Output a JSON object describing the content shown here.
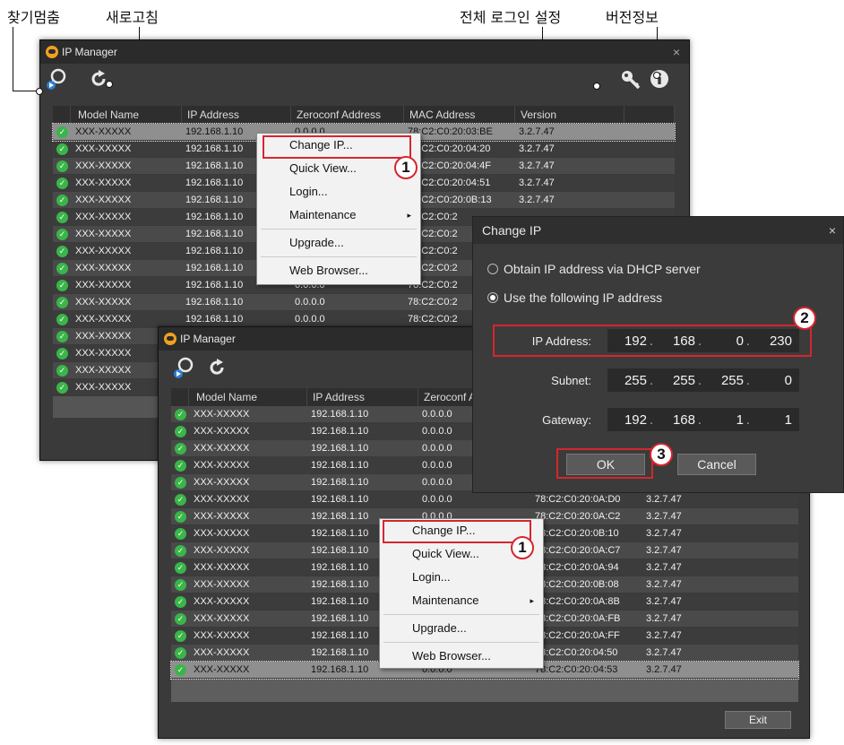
{
  "annotations": {
    "stop_search": "찾기멈춤",
    "refresh": "새로고침",
    "global_login": "전체 로그인 설정",
    "version_info": "버전정보",
    "badge_1": "1",
    "badge_2": "2",
    "badge_3": "3"
  },
  "window": {
    "title": "IP Manager",
    "close": "×",
    "exit_label": "Exit"
  },
  "table": {
    "headers": [
      "Model Name",
      "IP Address",
      "Zeroconf Address",
      "MAC Address",
      "Version"
    ]
  },
  "back_rows": [
    {
      "model": "XXX-XXXXX",
      "ip": "192.168.1.10",
      "zc": "0.0.0.0",
      "mac": "78:C2:C0:20:03:BE",
      "ver": "3.2.7.47"
    },
    {
      "model": "XXX-XXXXX",
      "ip": "192.168.1.10",
      "zc": "0.0.0.0",
      "mac": "78:C2:C0:20:04:20",
      "ver": "3.2.7.47"
    },
    {
      "model": "XXX-XXXXX",
      "ip": "192.168.1.10",
      "zc": "0.0.0.0",
      "mac": "78:C2:C0:20:04:4F",
      "ver": "3.2.7.47"
    },
    {
      "model": "XXX-XXXXX",
      "ip": "192.168.1.10",
      "zc": "0.0.0.0",
      "mac": "78:C2:C0:20:04:51",
      "ver": "3.2.7.47"
    },
    {
      "model": "XXX-XXXXX",
      "ip": "192.168.1.10",
      "zc": "0.0.0.0",
      "mac": "78:C2:C0:20:0B:13",
      "ver": "3.2.7.47"
    },
    {
      "model": "XXX-XXXXX",
      "ip": "192.168.1.10",
      "zc": "0.0.0.0",
      "mac": "78:C2:C0:2",
      "ver": ""
    },
    {
      "model": "XXX-XXXXX",
      "ip": "192.168.1.10",
      "zc": "0.0.0.0",
      "mac": "78:C2:C0:2",
      "ver": ""
    },
    {
      "model": "XXX-XXXXX",
      "ip": "192.168.1.10",
      "zc": "0.0.0.0",
      "mac": "78:C2:C0:2",
      "ver": ""
    },
    {
      "model": "XXX-XXXXX",
      "ip": "192.168.1.10",
      "zc": "0.0.0.0",
      "mac": "78:C2:C0:2",
      "ver": ""
    },
    {
      "model": "XXX-XXXXX",
      "ip": "192.168.1.10",
      "zc": "0.0.0.0",
      "mac": "78:C2:C0:2",
      "ver": ""
    },
    {
      "model": "XXX-XXXXX",
      "ip": "192.168.1.10",
      "zc": "0.0.0.0",
      "mac": "78:C2:C0:2",
      "ver": ""
    },
    {
      "model": "XXX-XXXXX",
      "ip": "192.168.1.10",
      "zc": "0.0.0.0",
      "mac": "78:C2:C0:2",
      "ver": ""
    },
    {
      "model": "XXX-XXXXX",
      "ip": "",
      "zc": "",
      "mac": "",
      "ver": ""
    },
    {
      "model": "XXX-XXXXX",
      "ip": "",
      "zc": "",
      "mac": "",
      "ver": ""
    },
    {
      "model": "XXX-XXXXX",
      "ip": "",
      "zc": "",
      "mac": "",
      "ver": ""
    },
    {
      "model": "XXX-XXXXX",
      "ip": "",
      "zc": "",
      "mac": "",
      "ver": ""
    }
  ],
  "front_rows": [
    {
      "model": "XXX-XXXXX",
      "ip": "192.168.1.10",
      "zc": "0.0.0.0",
      "mac": "",
      "ver": ""
    },
    {
      "model": "XXX-XXXXX",
      "ip": "192.168.1.10",
      "zc": "0.0.0.0",
      "mac": "",
      "ver": ""
    },
    {
      "model": "XXX-XXXXX",
      "ip": "192.168.1.10",
      "zc": "0.0.0.0",
      "mac": "",
      "ver": ""
    },
    {
      "model": "XXX-XXXXX",
      "ip": "192.168.1.10",
      "zc": "0.0.0.0",
      "mac": "",
      "ver": ""
    },
    {
      "model": "XXX-XXXXX",
      "ip": "192.168.1.10",
      "zc": "0.0.0.0",
      "mac": "",
      "ver": ""
    },
    {
      "model": "XXX-XXXXX",
      "ip": "192.168.1.10",
      "zc": "0.0.0.0",
      "mac": "78:C2:C0:20:0A:D0",
      "ver": "3.2.7.47"
    },
    {
      "model": "XXX-XXXXX",
      "ip": "192.168.1.10",
      "zc": "0.0.0.0",
      "mac": "78:C2:C0:20:0A:C2",
      "ver": "3.2.7.47"
    },
    {
      "model": "XXX-XXXXX",
      "ip": "192.168.1.10",
      "zc": "",
      "mac": "78:C2:C0:20:0B:10",
      "ver": "3.2.7.47"
    },
    {
      "model": "XXX-XXXXX",
      "ip": "192.168.1.10",
      "zc": "",
      "mac": "78:C2:C0:20:0A:C7",
      "ver": "3.2.7.47"
    },
    {
      "model": "XXX-XXXXX",
      "ip": "192.168.1.10",
      "zc": "",
      "mac": "78:C2:C0:20:0A:94",
      "ver": "3.2.7.47"
    },
    {
      "model": "XXX-XXXXX",
      "ip": "192.168.1.10",
      "zc": "",
      "mac": "78:C2:C0:20:0B:08",
      "ver": "3.2.7.47"
    },
    {
      "model": "XXX-XXXXX",
      "ip": "192.168.1.10",
      "zc": "",
      "mac": "78:C2:C0:20:0A:8B",
      "ver": "3.2.7.47"
    },
    {
      "model": "XXX-XXXXX",
      "ip": "192.168.1.10",
      "zc": "",
      "mac": "78:C2:C0:20:0A:FB",
      "ver": "3.2.7.47"
    },
    {
      "model": "XXX-XXXXX",
      "ip": "192.168.1.10",
      "zc": "",
      "mac": "78:C2:C0:20:0A:FF",
      "ver": "3.2.7.47"
    },
    {
      "model": "XXX-XXXXX",
      "ip": "192.168.1.10",
      "zc": "",
      "mac": "78:C2:C0:20:04:50",
      "ver": "3.2.7.47"
    },
    {
      "model": "XXX-XXXXX",
      "ip": "192.168.1.10",
      "zc": "0.0.0.0",
      "mac": "78:C2:C0:20:04:53",
      "ver": "3.2.7.47"
    }
  ],
  "context_menu": {
    "change_ip": "Change IP...",
    "quick_view": "Quick View...",
    "login": "Login...",
    "maintenance": "Maintenance",
    "upgrade": "Upgrade...",
    "web_browser": "Web Browser...",
    "arrow": "▸"
  },
  "dialog": {
    "title": "Change IP",
    "close": "×",
    "option_dhcp": "Obtain IP address via DHCP server",
    "option_static": "Use the following IP address",
    "ip_label": "IP Address:",
    "subnet_label": "Subnet:",
    "gateway_label": "Gateway:",
    "ip": [
      "192",
      "168",
      "0",
      "230"
    ],
    "subnet": [
      "255",
      "255",
      "255",
      "0"
    ],
    "gateway": [
      "192",
      "168",
      "1",
      "1"
    ],
    "ok": "OK",
    "cancel": "Cancel"
  }
}
